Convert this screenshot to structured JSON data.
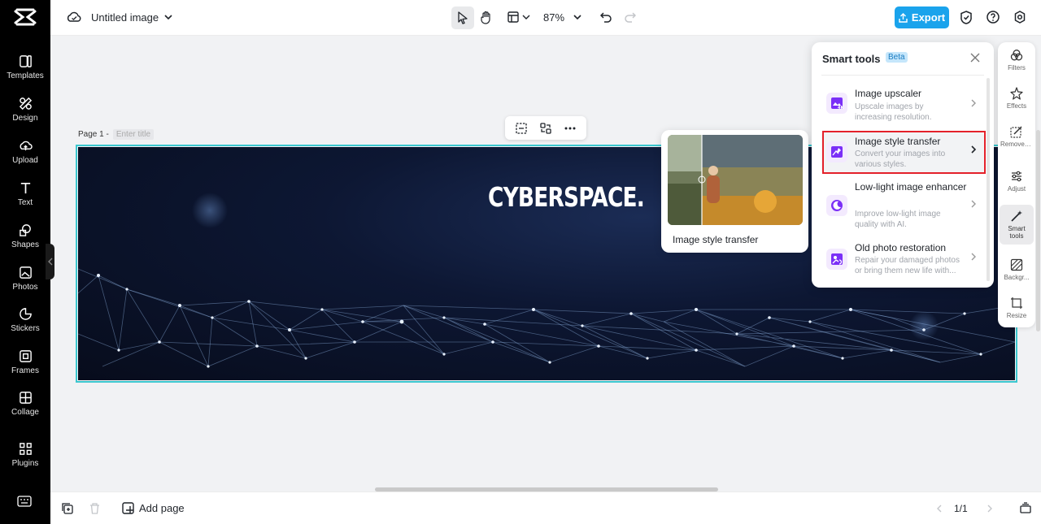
{
  "app": {
    "title": "Untitled image"
  },
  "sidebar": {
    "items": [
      {
        "label": "Templates",
        "icon": "templates-icon"
      },
      {
        "label": "Design",
        "icon": "design-icon"
      },
      {
        "label": "Upload",
        "icon": "upload-icon"
      },
      {
        "label": "Text",
        "icon": "text-icon"
      },
      {
        "label": "Shapes",
        "icon": "shapes-icon"
      },
      {
        "label": "Photos",
        "icon": "photos-icon"
      },
      {
        "label": "Stickers",
        "icon": "stickers-icon"
      },
      {
        "label": "Frames",
        "icon": "frames-icon"
      },
      {
        "label": "Collage",
        "icon": "collage-icon"
      },
      {
        "label": "Plugins",
        "icon": "plugins-icon"
      }
    ]
  },
  "toolbar": {
    "zoom": "87%",
    "export_label": "Export"
  },
  "canvas": {
    "page_label": "Page 1 -",
    "title_placeholder": "Enter title",
    "banner_text": "CYBERSPACE."
  },
  "preview": {
    "label": "Image style transfer"
  },
  "smart_tools": {
    "title": "Smart tools",
    "badge": "Beta",
    "tools": [
      {
        "name": "Image upscaler",
        "desc": "Upscale images by increasing resolution."
      },
      {
        "name": "Image style transfer",
        "desc": "Convert your images into various styles."
      },
      {
        "name": "Low-light image enhancer",
        "desc": "Improve low-light image quality with AI."
      },
      {
        "name": "Old photo restoration",
        "desc": "Repair your damaged photos or bring them new life with..."
      }
    ]
  },
  "right_rail": {
    "items": [
      {
        "label": "Filters"
      },
      {
        "label": "Effects"
      },
      {
        "label": "Remove backgr..."
      },
      {
        "label": "Adjust"
      },
      {
        "label": "Smart tools"
      },
      {
        "label": "Backgr..."
      },
      {
        "label": "Resize"
      }
    ]
  },
  "bottom": {
    "add_page": "Add page",
    "page_count": "1/1"
  },
  "colors": {
    "accent": "#1aa3ec",
    "selection": "#3bc7cf",
    "highlight": "#e4212a",
    "tool_icon": "#7b2ff7"
  }
}
